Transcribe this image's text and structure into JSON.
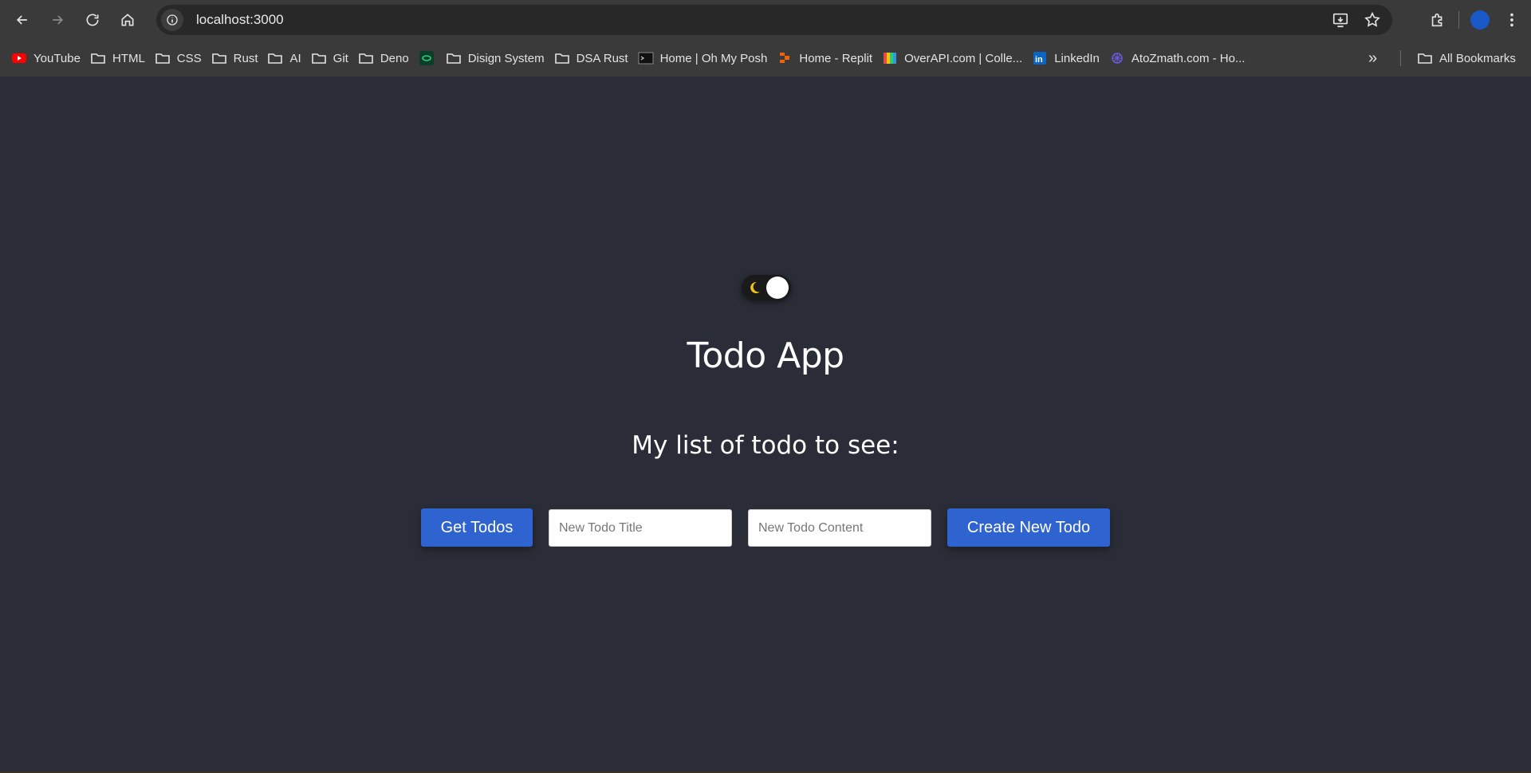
{
  "browser": {
    "url": "localhost:3000",
    "bookmarks": [
      {
        "label": "YouTube",
        "icon": "youtube-icon"
      },
      {
        "label": "HTML",
        "icon": "folder-icon"
      },
      {
        "label": "CSS",
        "icon": "folder-icon"
      },
      {
        "label": "Rust",
        "icon": "folder-icon"
      },
      {
        "label": "AI",
        "icon": "folder-icon"
      },
      {
        "label": "Git",
        "icon": "folder-icon"
      },
      {
        "label": "Deno",
        "icon": "folder-icon"
      },
      {
        "label": "",
        "icon": "green-app-icon"
      },
      {
        "label": "Disign System",
        "icon": "folder-icon"
      },
      {
        "label": "DSA Rust",
        "icon": "folder-icon"
      },
      {
        "label": "Home | Oh My Posh",
        "icon": "terminal-icon"
      },
      {
        "label": "Home - Replit",
        "icon": "replit-icon"
      },
      {
        "label": "OverAPI.com | Colle...",
        "icon": "overapi-icon"
      },
      {
        "label": "LinkedIn",
        "icon": "linkedin-icon"
      },
      {
        "label": "AtoZmath.com - Ho...",
        "icon": "atozmath-icon"
      }
    ],
    "more_label": "»",
    "all_bookmarks_label": "All Bookmarks"
  },
  "app": {
    "theme_toggle": {
      "mode": "dark"
    },
    "title": "Todo App",
    "subtitle": "My list of todo to see:",
    "get_todos_label": "Get Todos",
    "title_placeholder": "New Todo Title",
    "content_placeholder": "New Todo Content",
    "create_label": "Create New Todo"
  },
  "colors": {
    "page_background": "#2a2d37",
    "button": "#2f63cf",
    "browser_chrome": "#3a3a3a"
  }
}
